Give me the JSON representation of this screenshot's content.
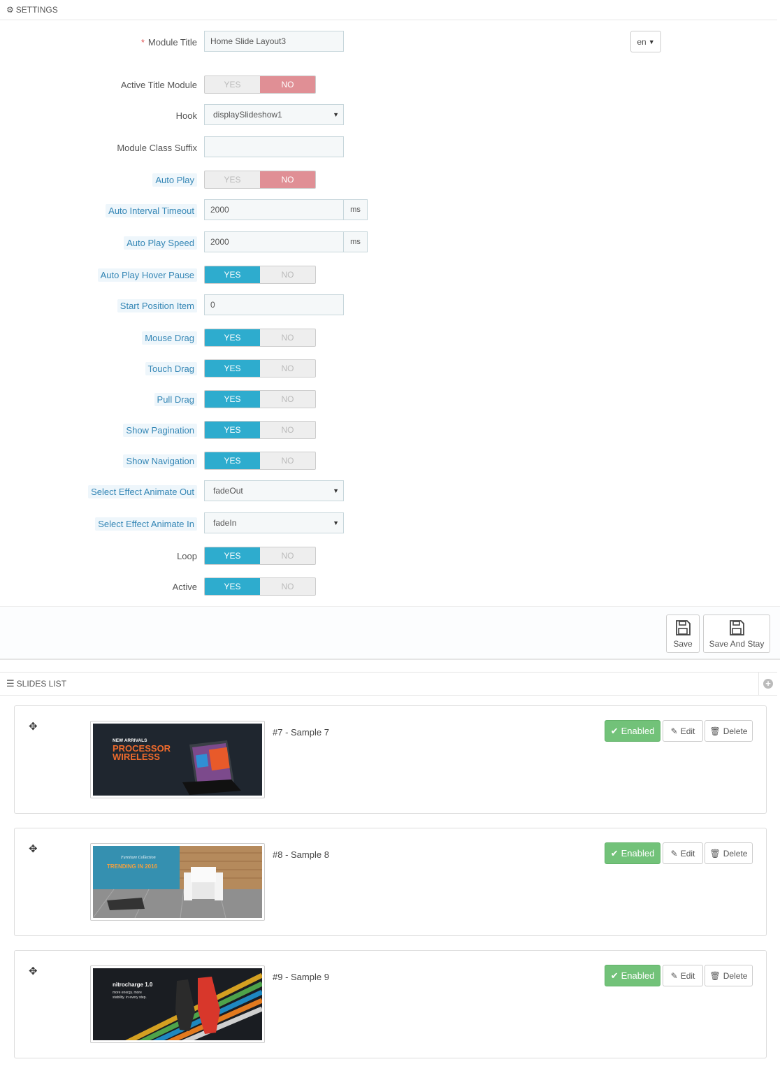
{
  "settings": {
    "title": "SETTINGS",
    "lang": "en",
    "fields": {
      "module_title": {
        "label": "Module Title",
        "required": "*",
        "value": "Home Slide Layout3"
      },
      "active_title": {
        "label": "Active Title Module",
        "yes": "YES",
        "no": "NO",
        "value": "NO"
      },
      "hook": {
        "label": "Hook",
        "value": "displaySlideshow1"
      },
      "class_suffix": {
        "label": "Module Class Suffix",
        "value": ""
      },
      "auto_play": {
        "label": "Auto Play",
        "yes": "YES",
        "no": "NO",
        "value": "NO"
      },
      "auto_interval": {
        "label": "Auto Interval Timeout",
        "value": "2000",
        "unit": "ms"
      },
      "auto_speed": {
        "label": "Auto Play Speed",
        "value": "2000",
        "unit": "ms"
      },
      "hover_pause": {
        "label": "Auto Play Hover Pause",
        "yes": "YES",
        "no": "NO",
        "value": "YES"
      },
      "start_position": {
        "label": "Start Position Item",
        "value": "0"
      },
      "mouse_drag": {
        "label": "Mouse Drag",
        "yes": "YES",
        "no": "NO",
        "value": "YES"
      },
      "touch_drag": {
        "label": "Touch Drag",
        "yes": "YES",
        "no": "NO",
        "value": "YES"
      },
      "pull_drag": {
        "label": "Pull Drag",
        "yes": "YES",
        "no": "NO",
        "value": "YES"
      },
      "show_pagination": {
        "label": "Show Pagination",
        "yes": "YES",
        "no": "NO",
        "value": "YES"
      },
      "show_navigation": {
        "label": "Show Navigation",
        "yes": "YES",
        "no": "NO",
        "value": "YES"
      },
      "effect_out": {
        "label": "Select Effect Animate Out",
        "value": "fadeOut"
      },
      "effect_in": {
        "label": "Select Effect Animate In",
        "value": "fadeIn"
      },
      "loop": {
        "label": "Loop",
        "yes": "YES",
        "no": "NO",
        "value": "YES"
      },
      "active": {
        "label": "Active",
        "yes": "YES",
        "no": "NO",
        "value": "YES"
      }
    }
  },
  "footer": {
    "save": "Save",
    "save_stay": "Save And Stay"
  },
  "slides_list": {
    "title": "SLIDES LIST",
    "enabled_label": "Enabled",
    "edit_label": "Edit",
    "delete_label": "Delete",
    "items": [
      {
        "title": "#7 - Sample 7",
        "thumb": {
          "line1": "NEW ARRIVALS",
          "line2": "PROCESSOR",
          "line3": "WIRELESS"
        }
      },
      {
        "title": "#8 - Sample 8",
        "thumb": {
          "line1": "Furniture Collection",
          "line2": "TRENDING IN 2016"
        }
      },
      {
        "title": "#9 - Sample 9",
        "thumb": {
          "line1": "nitrocharge 1.0",
          "line2": "more energy. more",
          "line3": "stability. in every step."
        }
      }
    ]
  },
  "colors": {
    "accent": "#2eacce",
    "no_active": "#e08f95",
    "enabled": "#72c279",
    "hint": "#3486b5"
  }
}
